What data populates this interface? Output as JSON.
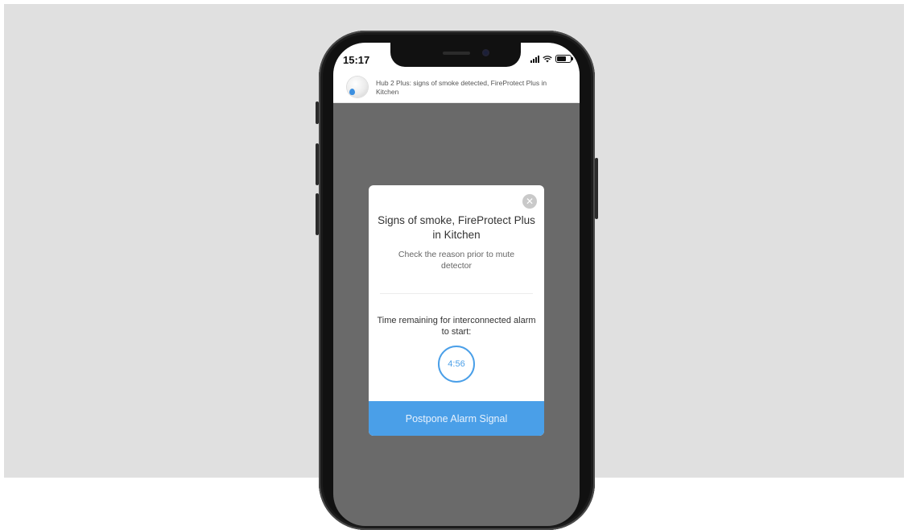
{
  "status_bar": {
    "time": "15:17"
  },
  "notification": {
    "icon": "smoke-detector-icon",
    "text": "Hub 2 Plus: signs of smoke detected, FireProtect Plus in Kitchen"
  },
  "modal": {
    "title": "Signs of smoke, FireProtect Plus in Kitchen",
    "subtitle": "Check the reason prior to mute detector",
    "timer_label": "Time remaining for interconnected alarm to start:",
    "timer_value": "4:56",
    "button_label": "Postpone Alarm Signal"
  },
  "colors": {
    "accent": "#4a9fe8",
    "overlay": "#6a6a6a",
    "background": "#e0e0e0"
  }
}
